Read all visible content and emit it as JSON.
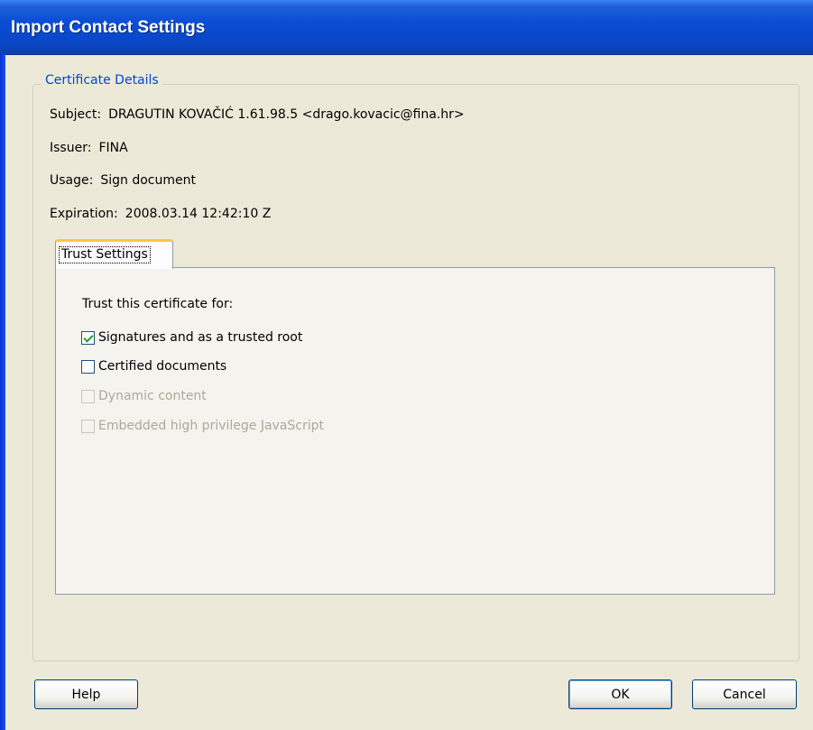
{
  "window": {
    "title": "Import Contact Settings"
  },
  "certificate": {
    "legend": "Certificate Details",
    "subject_label": "Subject:",
    "subject_value": "DRAGUTIN KOVAČIĆ 1.61.98.5 <drago.kovacic@fina.hr>",
    "issuer_label": "Issuer:",
    "issuer_value": "FINA",
    "usage_label": "Usage:",
    "usage_value": "Sign document",
    "expiration_label": "Expiration:",
    "expiration_value": "2008.03.14 12:42:10 Z"
  },
  "tabs": [
    {
      "label": "Trust Settings",
      "active": true
    }
  ],
  "trust": {
    "heading": "Trust this certificate for:",
    "options": [
      {
        "label": "Signatures and as a trusted root",
        "checked": true,
        "enabled": true
      },
      {
        "label": "Certified documents",
        "checked": false,
        "enabled": true
      },
      {
        "label": "Dynamic content",
        "checked": false,
        "enabled": false
      },
      {
        "label": "Embedded high privilege JavaScript",
        "checked": false,
        "enabled": false
      }
    ]
  },
  "buttons": {
    "help": "Help",
    "ok": "OK",
    "cancel": "Cancel"
  },
  "colors": {
    "titlebar": "#0a4ed6",
    "dialog_bg": "#ece9d8",
    "legend_text": "#0046d5",
    "tab_highlight": "#ffc83c",
    "checkmark": "#21a121"
  }
}
